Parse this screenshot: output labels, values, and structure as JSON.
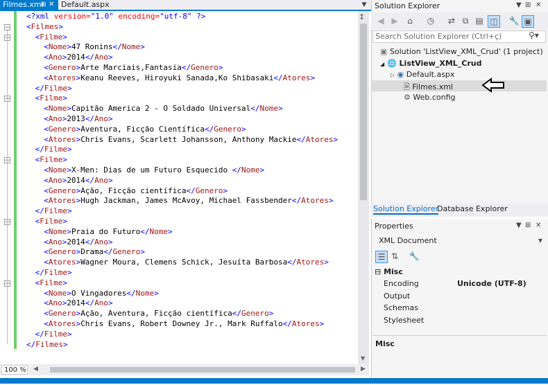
{
  "editor": {
    "tabs": [
      {
        "label": "Filmes.xml",
        "active": true
      },
      {
        "label": "Default.aspx",
        "active": false
      }
    ],
    "zoom": "100 %",
    "xml_decl": {
      "open": "<?xml ",
      "attr1": "version=",
      "val1": "\"1.0\"",
      "attr2": " encoding=",
      "val2": "\"utf-8\"",
      "close": " ?>"
    },
    "root_tag": "Filmes",
    "film_tag": "Filme",
    "films": [
      {
        "Nome": "47 Ronins",
        "Ano": "2014",
        "Genero": "Arte Marciais,Fantasia",
        "Atores": "Keanu Reeves, Hiroyuki Sanada,Ko Shibasaki"
      },
      {
        "Nome": "Capitão America 2 - O Soldado Universal",
        "Ano": "2013",
        "Genero": "Aventura, Ficção Científica",
        "Atores": "Chris Evans, Scarlett Johansson, Anthony Mackie"
      },
      {
        "Nome": "X-Men: Dias de um Futuro Esquecido ",
        "Ano": "2014",
        "Genero": "Ação, Ficção científica",
        "Atores": "Hugh Jackman, James McAvoy, Michael Fassbender"
      },
      {
        "Nome": "Praia do Futuro",
        "Ano": "2014",
        "Genero": "Drama",
        "Atores": "Wagner Moura, Clemens Schick, Jesuíta Barbosa"
      },
      {
        "Nome": "O Vingadores",
        "Ano": "2014",
        "Genero": "Ação, Aventura, Ficção científica",
        "Atores": "Chris Evans, Robert Downey Jr., Mark Ruffalo"
      }
    ]
  },
  "solution_explorer": {
    "title": "Solution Explorer",
    "search_placeholder": "Search Solution Explorer (Ctrl+ç)",
    "items": {
      "solution": "Solution 'ListView_XML_Crud' (1 project)",
      "project": "ListView_XML_Crud",
      "default": "Default.aspx",
      "filmes": "Filmes.xml",
      "webconfig": "Web.config"
    },
    "bottom_tabs": [
      "Solution Explorer",
      "Database Explorer"
    ]
  },
  "properties": {
    "title": "Properties",
    "object": "XML Document",
    "category": "Misc",
    "rows": [
      {
        "name": "Encoding",
        "value": "Unicode (UTF-8)"
      },
      {
        "name": "Output",
        "value": ""
      },
      {
        "name": "Schemas",
        "value": ""
      },
      {
        "name": "Stylesheet",
        "value": ""
      }
    ],
    "description_title": "Misc"
  },
  "colors": {
    "accent": "#007acc",
    "xml_tag": "#a31515",
    "xml_bracket": "#0000ff",
    "xml_attr": "#ff0000",
    "change_margin": "#6ecf6e"
  }
}
